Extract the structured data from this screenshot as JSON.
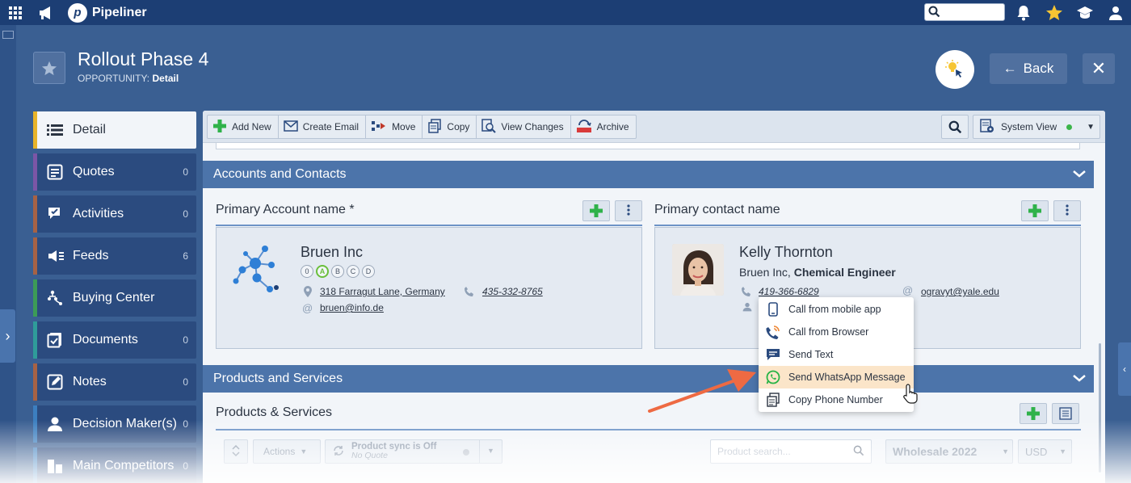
{
  "topbar": {
    "brand": "Pipeliner",
    "search_placeholder": ""
  },
  "header": {
    "title": "Rollout Phase 4",
    "entity_type": "OPPORTUNITY:",
    "entity_view": "Detail",
    "back_label": "Back"
  },
  "nav": {
    "items": [
      {
        "label": "Detail",
        "count": "",
        "color": "#e8b42a",
        "icon": "list-icon"
      },
      {
        "label": "Quotes",
        "count": "0",
        "color": "#7b56a6",
        "icon": "quote-icon"
      },
      {
        "label": "Activities",
        "count": "0",
        "color": "#a66245",
        "icon": "activities-icon"
      },
      {
        "label": "Feeds",
        "count": "6",
        "color": "#a66245",
        "icon": "feed-icon"
      },
      {
        "label": "Buying Center",
        "count": "",
        "color": "#3c9b57",
        "icon": "buying-center-icon"
      },
      {
        "label": "Documents",
        "count": "0",
        "color": "#2f9c9a",
        "icon": "documents-icon"
      },
      {
        "label": "Notes",
        "count": "0",
        "color": "#a66245",
        "icon": "notes-icon"
      },
      {
        "label": "Decision Maker(s)",
        "count": "0",
        "color": "#3c7fc0",
        "icon": "person-icon"
      },
      {
        "label": "Main Competitors",
        "count": "0",
        "color": "#3c7fc0",
        "icon": "buildings-icon"
      }
    ]
  },
  "toolbar": {
    "add_new": "Add New",
    "create_email": "Create Email",
    "move": "Move",
    "copy": "Copy",
    "view_changes": "View Changes",
    "archive": "Archive",
    "view": "System View"
  },
  "accounts_section": {
    "title": "Accounts and Contacts",
    "account_label": "Primary Account name *",
    "contact_label": "Primary contact name",
    "account": {
      "name": "Bruen Inc",
      "grades": [
        "0",
        "A",
        "B",
        "C",
        "D"
      ],
      "active_grade": "A",
      "address": "318 Farragut Lane, Germany",
      "phone": "435-332-8765",
      "email": "bruen@info.de"
    },
    "contact": {
      "name": "Kelly Thornton",
      "company": "Bruen Inc,",
      "position": "Chemical Engineer",
      "phone": "419-366-6829",
      "email": "ogravyt@yale.edu"
    }
  },
  "phone_menu": {
    "items": [
      {
        "label": "Call from mobile app",
        "icon": "mobile-phone-icon"
      },
      {
        "label": "Call from Browser",
        "icon": "browser-call-icon"
      },
      {
        "label": "Send Text",
        "icon": "sms-icon"
      },
      {
        "label": "Send WhatsApp Message",
        "icon": "whatsapp-icon"
      },
      {
        "label": "Copy Phone Number",
        "icon": "copy-icon"
      }
    ],
    "highlighted": "Send WhatsApp Message"
  },
  "products_section": {
    "title": "Products and Services",
    "label": "Products & Services",
    "actions": "Actions",
    "sync_title": "Product sync is Off",
    "sync_sub": "No Quote",
    "search_placeholder": "Product search...",
    "price_list": "Wholesale 2022",
    "currency": "USD"
  },
  "colors": {
    "topbar": "#1c3e74",
    "section": "#4c74aa",
    "accent_green": "#2fb24a",
    "highlight": "#fbe5c9",
    "arrow": "#ee6a43"
  }
}
